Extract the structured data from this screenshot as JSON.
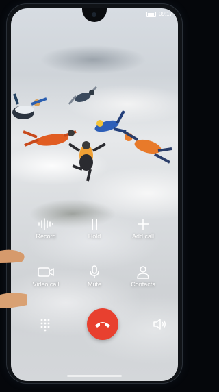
{
  "status_bar": {
    "time": "09:17"
  },
  "call_controls": {
    "row1": [
      {
        "label": "Record",
        "icon": "waveform-icon"
      },
      {
        "label": "Hold",
        "icon": "pause-icon"
      },
      {
        "label": "Add call",
        "icon": "plus-icon"
      }
    ],
    "row2": [
      {
        "label": "Video call",
        "icon": "video-camera-icon"
      },
      {
        "label": "Mute",
        "icon": "microphone-icon"
      },
      {
        "label": "Contacts",
        "icon": "person-icon"
      }
    ]
  },
  "bottom_bar": {
    "left_icon": "dialpad-icon",
    "center_icon": "hang-up-icon",
    "right_icon": "speaker-icon"
  },
  "colors": {
    "hangup": "#e8402f",
    "frame": "#101317"
  }
}
